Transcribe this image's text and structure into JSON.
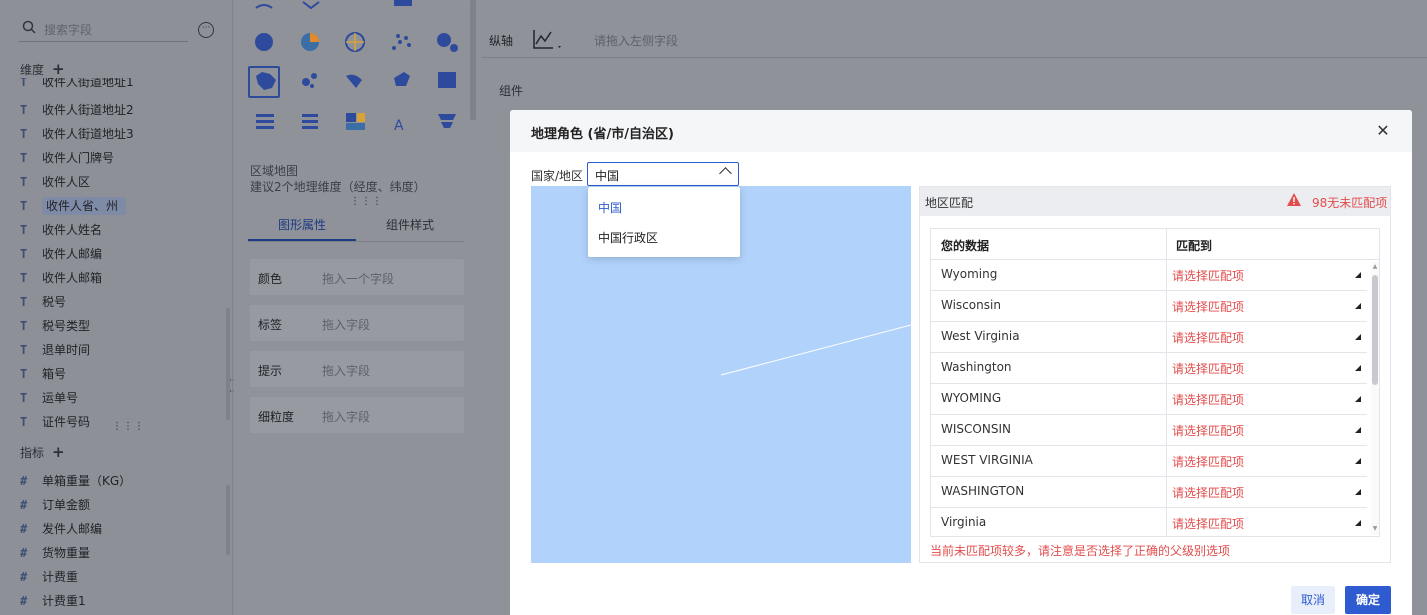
{
  "left_panel": {
    "search_placeholder": "搜索字段",
    "dimensions_title": "维度",
    "dimensions": [
      {
        "type": "T",
        "label": "收件人街道地址1"
      },
      {
        "type": "T",
        "label": "收件人街道地址2"
      },
      {
        "type": "T",
        "label": "收件人街道地址3"
      },
      {
        "type": "T",
        "label": "收件人门牌号"
      },
      {
        "type": "T",
        "label": "收件人区"
      },
      {
        "type": "T",
        "label": "收件人省、州"
      },
      {
        "type": "T",
        "label": "收件人姓名"
      },
      {
        "type": "T",
        "label": "收件人邮编"
      },
      {
        "type": "T",
        "label": "收件人邮箱"
      },
      {
        "type": "T",
        "label": "税号"
      },
      {
        "type": "T",
        "label": "税号类型"
      },
      {
        "type": "T",
        "label": "退单时间"
      },
      {
        "type": "T",
        "label": "箱号"
      },
      {
        "type": "T",
        "label": "运单号"
      },
      {
        "type": "T",
        "label": "证件号码"
      }
    ],
    "measures_title": "指标",
    "measures": [
      {
        "type": "#",
        "label": "单箱重量（KG）"
      },
      {
        "type": "#",
        "label": "订单金额"
      },
      {
        "type": "#",
        "label": "发件人邮编"
      },
      {
        "type": "#",
        "label": "货物重量"
      },
      {
        "type": "#",
        "label": "计费重"
      },
      {
        "type": "#",
        "label": "计费重1"
      }
    ]
  },
  "mid_panel": {
    "map_type_title": "区域地图",
    "map_type_hint": "建议2个地理维度（经度、纬度）",
    "tab_graph": "图形属性",
    "tab_style": "组件样式",
    "props": [
      {
        "key": "颜色",
        "value": "拖入一个字段"
      },
      {
        "key": "标签",
        "value": "拖入字段"
      },
      {
        "key": "提示",
        "value": "拖入字段"
      },
      {
        "key": "细粒度",
        "value": "拖入字段"
      }
    ]
  },
  "right_panel": {
    "y_axis_label": "纵轴",
    "y_axis_placeholder": "请拖入左侧字段",
    "component_label": "组件"
  },
  "dialog": {
    "title": "地理角色 (省/市/自治区)",
    "country_label": "国家/地区",
    "country_value": "中国",
    "dropdown_options": [
      "中国",
      "中国行政区"
    ],
    "match_title": "地区匹配",
    "warning": "98无未匹配项",
    "col_data": "您的数据",
    "col_match": "匹配到",
    "rows": [
      {
        "data": "Wyoming",
        "match": "请选择匹配项"
      },
      {
        "data": "Wisconsin",
        "match": "请选择匹配项"
      },
      {
        "data": "West Virginia",
        "match": "请选择匹配项"
      },
      {
        "data": "Washington",
        "match": "请选择匹配项"
      },
      {
        "data": "WYOMING",
        "match": "请选择匹配项"
      },
      {
        "data": "WISCONSIN",
        "match": "请选择匹配项"
      },
      {
        "data": "WEST VIRGINIA",
        "match": "请选择匹配项"
      },
      {
        "data": "WASHINGTON",
        "match": "请选择匹配项"
      },
      {
        "data": "Virginia",
        "match": "请选择匹配项"
      }
    ],
    "footnote": "当前未匹配项较多，请注意是否选择了正确的父级别选项",
    "cancel": "取消",
    "confirm": "确定"
  },
  "colors": {
    "accent": "#2f5bd0",
    "warning": "#e34d4d",
    "map_bg": "#b1d3fb"
  }
}
